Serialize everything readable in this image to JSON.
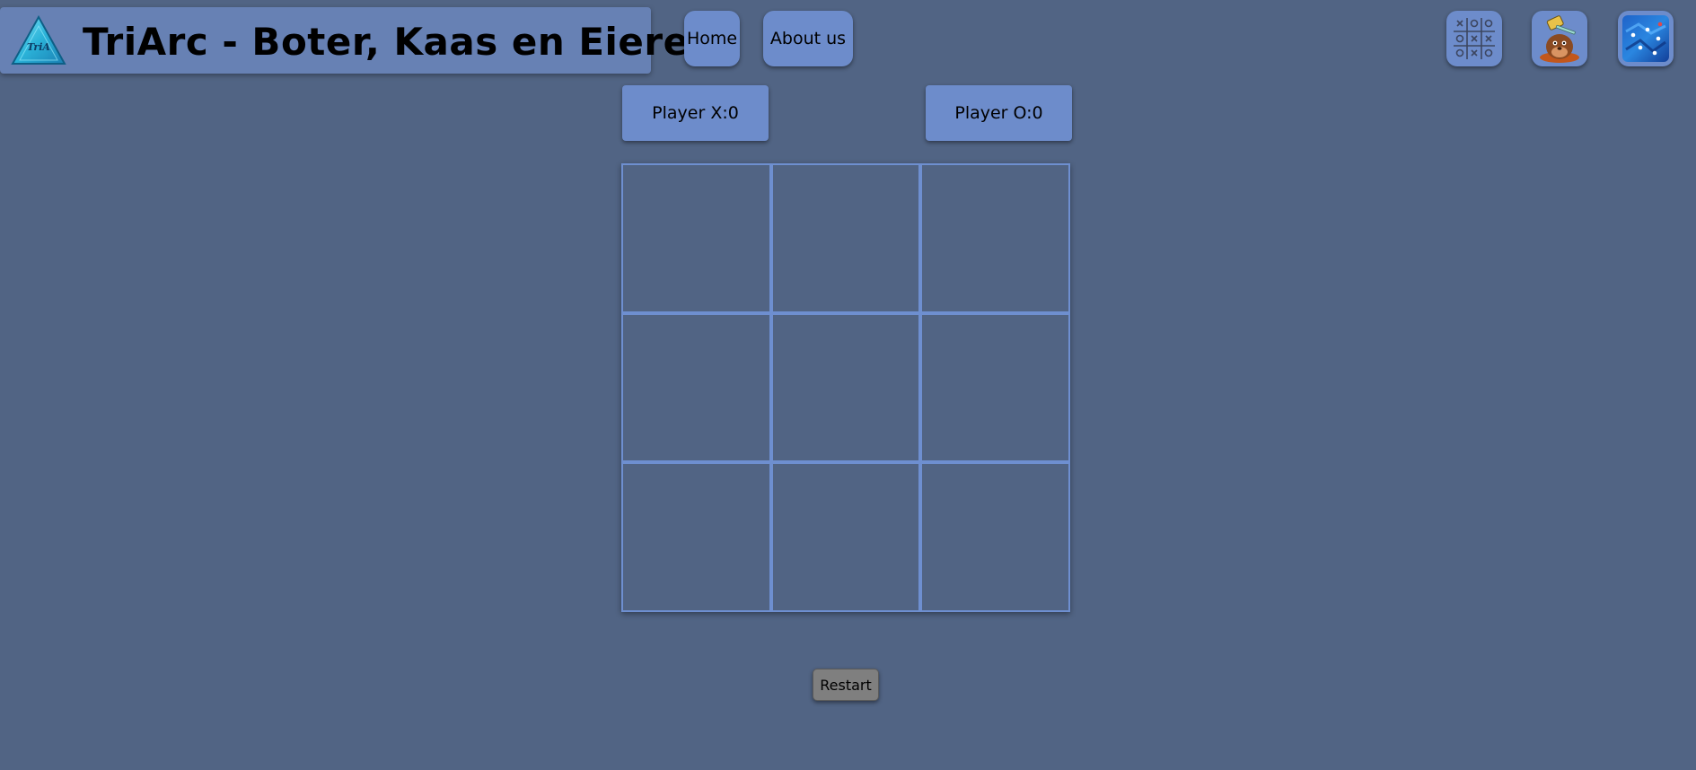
{
  "header": {
    "title": "TriArc - Boter, Kaas en Eieren",
    "logo_text": "TriA"
  },
  "nav": {
    "home_label": "Home",
    "about_label": "About us"
  },
  "game_links": [
    {
      "icon": "tic-tac-toe-icon"
    },
    {
      "icon": "whack-a-mole-icon"
    },
    {
      "icon": "blue-dots-game-icon"
    }
  ],
  "scoreboard": {
    "player_x": "Player X:0",
    "player_o": "Player O:0"
  },
  "board": {
    "cells": [
      "",
      "",
      "",
      "",
      "",
      "",
      "",
      "",
      ""
    ]
  },
  "controls": {
    "restart_label": "Restart"
  },
  "colors": {
    "background": "#516484",
    "panel": "#6d8ccb",
    "grid_line": "#6e8fd0",
    "restart": "#7f7f7f"
  }
}
